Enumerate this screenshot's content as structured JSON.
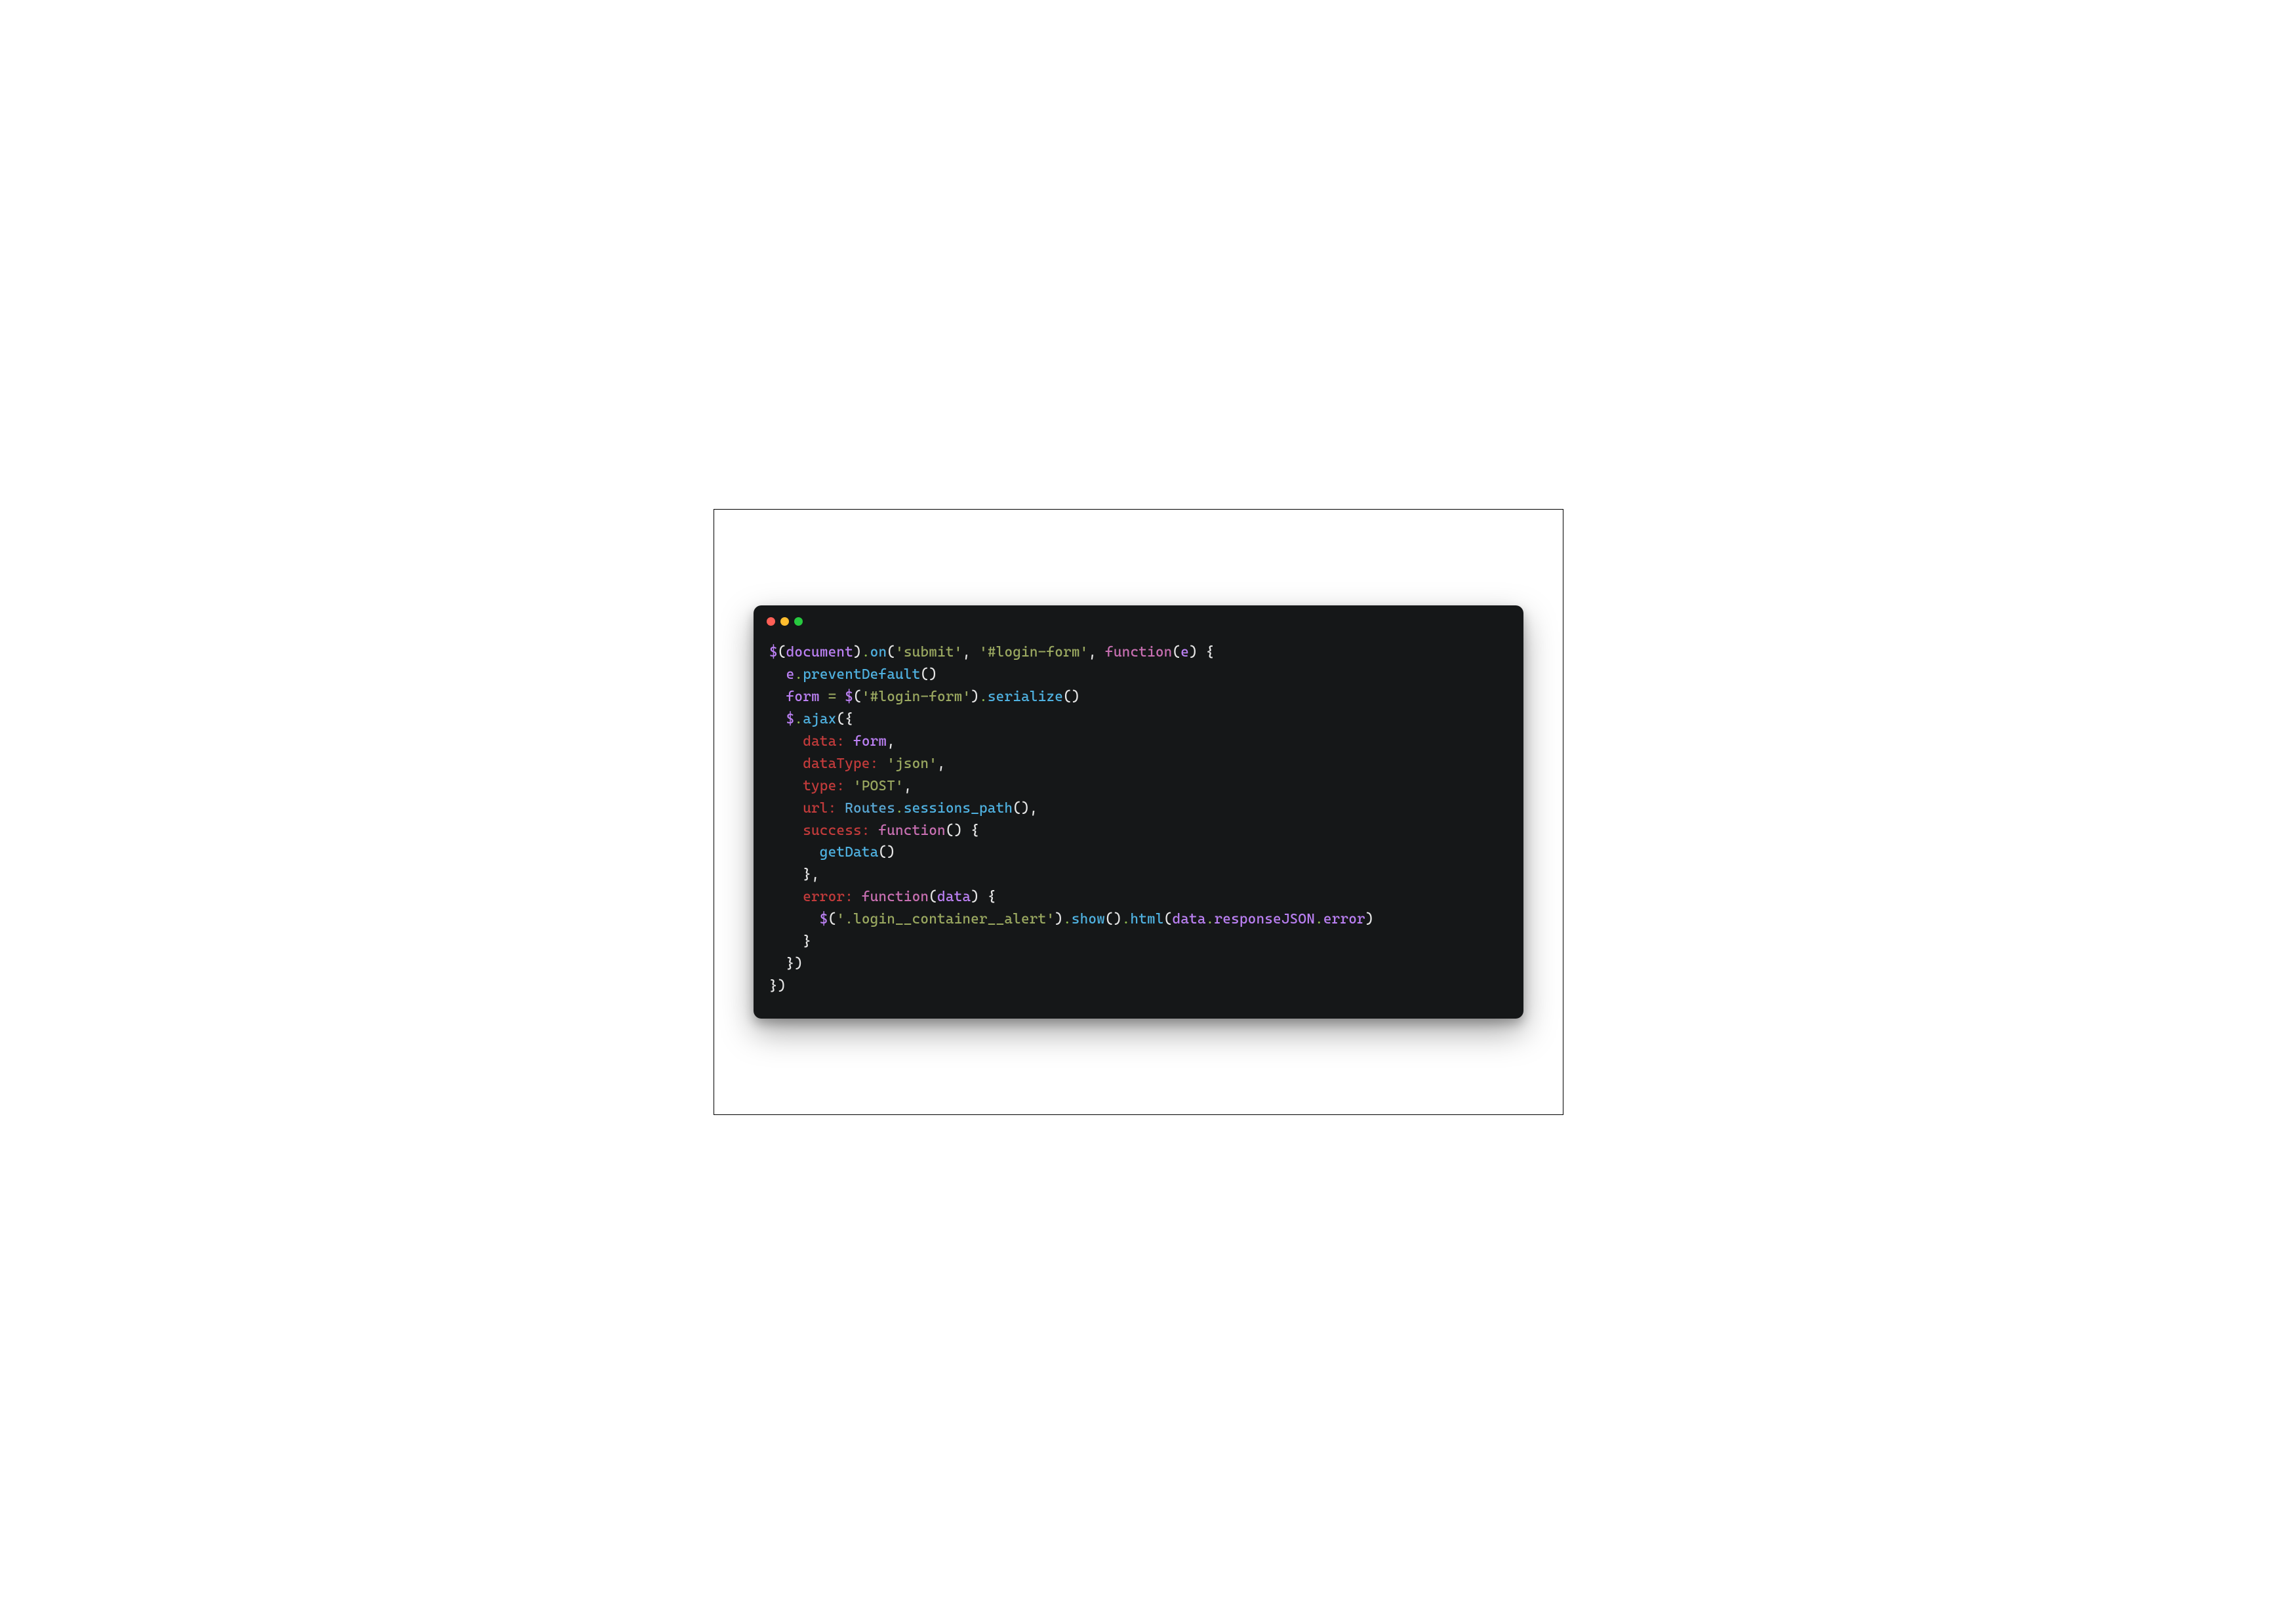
{
  "window": {
    "traffic_lights": [
      "red",
      "yellow",
      "green"
    ]
  },
  "colors": {
    "default": "#d1d1d1",
    "punct": "#e6e6e6",
    "var": "#bb80f3",
    "method": "#4fb1e0",
    "string": "#9aa860",
    "keyword": "#c76fb1",
    "prop": "#c23b3b",
    "class": "#5aa9d6",
    "dot": "#8fbc4f",
    "assign": "#9aa860"
  },
  "code": {
    "lines": [
      [
        {
          "c": "var",
          "t": "$"
        },
        {
          "c": "punct",
          "t": "("
        },
        {
          "c": "var",
          "t": "document"
        },
        {
          "c": "punct",
          "t": ")"
        },
        {
          "c": "dot",
          "t": "."
        },
        {
          "c": "method",
          "t": "on"
        },
        {
          "c": "punct",
          "t": "("
        },
        {
          "c": "string",
          "t": "'submit'"
        },
        {
          "c": "punct",
          "t": ", "
        },
        {
          "c": "string",
          "t": "'#login-form'"
        },
        {
          "c": "punct",
          "t": ", "
        },
        {
          "c": "keyword",
          "t": "function"
        },
        {
          "c": "punct",
          "t": "("
        },
        {
          "c": "var",
          "t": "e"
        },
        {
          "c": "punct",
          "t": ") {"
        }
      ],
      [
        {
          "c": "default",
          "t": "  "
        },
        {
          "c": "var",
          "t": "e"
        },
        {
          "c": "dot",
          "t": "."
        },
        {
          "c": "method",
          "t": "preventDefault"
        },
        {
          "c": "punct",
          "t": "()"
        }
      ],
      [
        {
          "c": "default",
          "t": "  "
        },
        {
          "c": "var",
          "t": "form"
        },
        {
          "c": "default",
          "t": " "
        },
        {
          "c": "assign",
          "t": "="
        },
        {
          "c": "default",
          "t": " "
        },
        {
          "c": "var",
          "t": "$"
        },
        {
          "c": "punct",
          "t": "("
        },
        {
          "c": "string",
          "t": "'#login-form'"
        },
        {
          "c": "punct",
          "t": ")"
        },
        {
          "c": "dot",
          "t": "."
        },
        {
          "c": "method",
          "t": "serialize"
        },
        {
          "c": "punct",
          "t": "()"
        }
      ],
      [
        {
          "c": "default",
          "t": "  "
        },
        {
          "c": "var",
          "t": "$"
        },
        {
          "c": "dot",
          "t": "."
        },
        {
          "c": "method",
          "t": "ajax"
        },
        {
          "c": "punct",
          "t": "({"
        }
      ],
      [
        {
          "c": "default",
          "t": "    "
        },
        {
          "c": "prop",
          "t": "data:"
        },
        {
          "c": "default",
          "t": " "
        },
        {
          "c": "var",
          "t": "form"
        },
        {
          "c": "punct",
          "t": ","
        }
      ],
      [
        {
          "c": "default",
          "t": "    "
        },
        {
          "c": "prop",
          "t": "dataType:"
        },
        {
          "c": "default",
          "t": " "
        },
        {
          "c": "string",
          "t": "'json'"
        },
        {
          "c": "punct",
          "t": ","
        }
      ],
      [
        {
          "c": "default",
          "t": "    "
        },
        {
          "c": "prop",
          "t": "type:"
        },
        {
          "c": "default",
          "t": " "
        },
        {
          "c": "string",
          "t": "'POST'"
        },
        {
          "c": "punct",
          "t": ","
        }
      ],
      [
        {
          "c": "default",
          "t": "    "
        },
        {
          "c": "prop",
          "t": "url:"
        },
        {
          "c": "default",
          "t": " "
        },
        {
          "c": "class",
          "t": "Routes"
        },
        {
          "c": "dot",
          "t": "."
        },
        {
          "c": "method",
          "t": "sessions_path"
        },
        {
          "c": "punct",
          "t": "(),"
        }
      ],
      [
        {
          "c": "default",
          "t": "    "
        },
        {
          "c": "prop",
          "t": "success:"
        },
        {
          "c": "default",
          "t": " "
        },
        {
          "c": "keyword",
          "t": "function"
        },
        {
          "c": "punct",
          "t": "() {"
        }
      ],
      [
        {
          "c": "default",
          "t": "      "
        },
        {
          "c": "method",
          "t": "getData"
        },
        {
          "c": "punct",
          "t": "()"
        }
      ],
      [
        {
          "c": "default",
          "t": "    "
        },
        {
          "c": "punct",
          "t": "},"
        }
      ],
      [
        {
          "c": "default",
          "t": "    "
        },
        {
          "c": "prop",
          "t": "error:"
        },
        {
          "c": "default",
          "t": " "
        },
        {
          "c": "keyword",
          "t": "function"
        },
        {
          "c": "punct",
          "t": "("
        },
        {
          "c": "var",
          "t": "data"
        },
        {
          "c": "punct",
          "t": ") {"
        }
      ],
      [
        {
          "c": "default",
          "t": "      "
        },
        {
          "c": "var",
          "t": "$"
        },
        {
          "c": "punct",
          "t": "("
        },
        {
          "c": "string",
          "t": "'.login__container__alert'"
        },
        {
          "c": "punct",
          "t": ")"
        },
        {
          "c": "dot",
          "t": "."
        },
        {
          "c": "method",
          "t": "show"
        },
        {
          "c": "punct",
          "t": "()"
        },
        {
          "c": "dot",
          "t": "."
        },
        {
          "c": "method",
          "t": "html"
        },
        {
          "c": "punct",
          "t": "("
        },
        {
          "c": "var",
          "t": "data"
        },
        {
          "c": "dot",
          "t": "."
        },
        {
          "c": "var",
          "t": "responseJSON"
        },
        {
          "c": "dot",
          "t": "."
        },
        {
          "c": "var",
          "t": "error"
        },
        {
          "c": "punct",
          "t": ")"
        }
      ],
      [
        {
          "c": "default",
          "t": "    "
        },
        {
          "c": "punct",
          "t": "}"
        }
      ],
      [
        {
          "c": "default",
          "t": "  "
        },
        {
          "c": "punct",
          "t": "})"
        }
      ],
      [
        {
          "c": "punct",
          "t": "})"
        }
      ]
    ]
  }
}
